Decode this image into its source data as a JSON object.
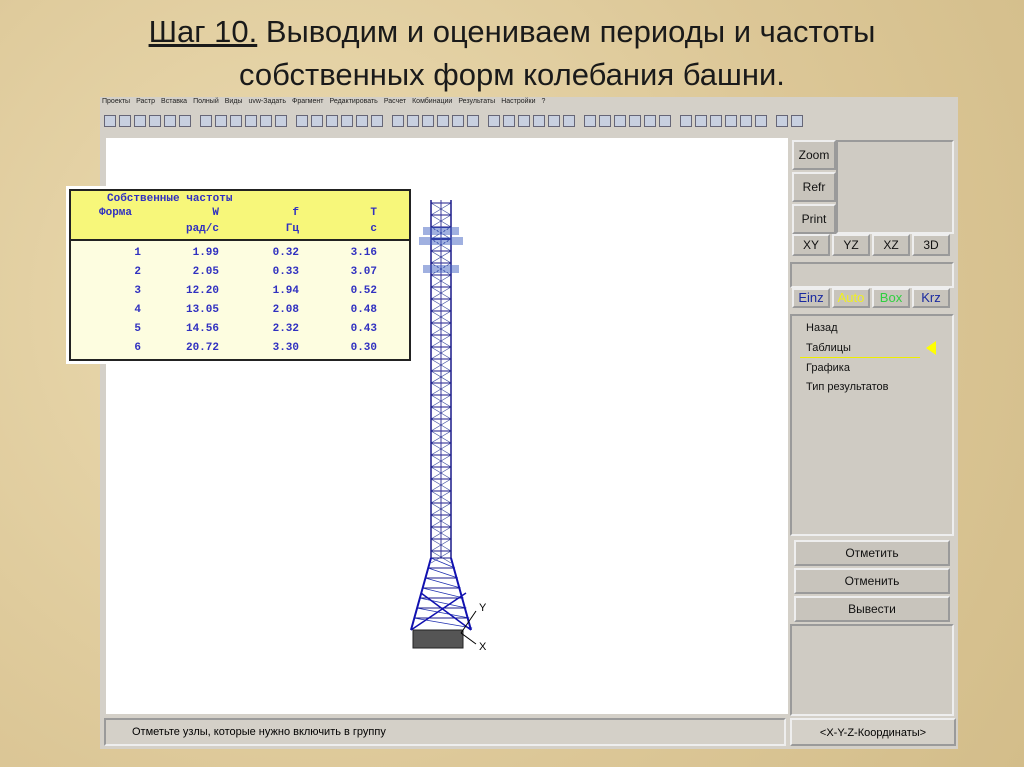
{
  "slide": {
    "step": "Шаг 10.",
    "title_rest": " Выводим и оцениваем периоды и частоты",
    "title_line2": "собственных форм колебания башни."
  },
  "menu": [
    "Проекты",
    "Растр",
    "Вставка",
    "Полный",
    "Виды",
    "uvw-Задать",
    "Фрагмент",
    "Редактировать",
    "Расчет",
    "Комбинации",
    "Результаты",
    "Настройки",
    "?"
  ],
  "table": {
    "title": "Собственные частоты",
    "headers": [
      "Форма",
      "W",
      "f",
      "T"
    ],
    "units": [
      "",
      "рад/с",
      "Гц",
      "с"
    ],
    "rows": [
      [
        "1",
        "1.99",
        "0.32",
        "3.16"
      ],
      [
        "2",
        "2.05",
        "0.33",
        "3.07"
      ],
      [
        "3",
        "12.20",
        "1.94",
        "0.52"
      ],
      [
        "4",
        "13.05",
        "2.08",
        "0.48"
      ],
      [
        "5",
        "14.56",
        "2.32",
        "0.43"
      ],
      [
        "6",
        "20.72",
        "3.30",
        "0.30"
      ]
    ]
  },
  "axes": {
    "y": "Y",
    "x": "X"
  },
  "right": {
    "zoom": "Zoom",
    "refr": "Refr",
    "print": "Print",
    "views": [
      "XY",
      "YZ",
      "XZ",
      "3D"
    ],
    "modes": [
      "Einz",
      "Auto",
      "Box",
      "Krz"
    ],
    "menu": [
      "Назад",
      "Таблицы",
      "Графика",
      "Тип результатов"
    ],
    "mark": "Отметить",
    "cancel": "Отменить",
    "output": "Вывести",
    "coords": "<X-Y-Z-Координаты>"
  },
  "status": "Отметьте узлы, которые нужно включить в группу"
}
